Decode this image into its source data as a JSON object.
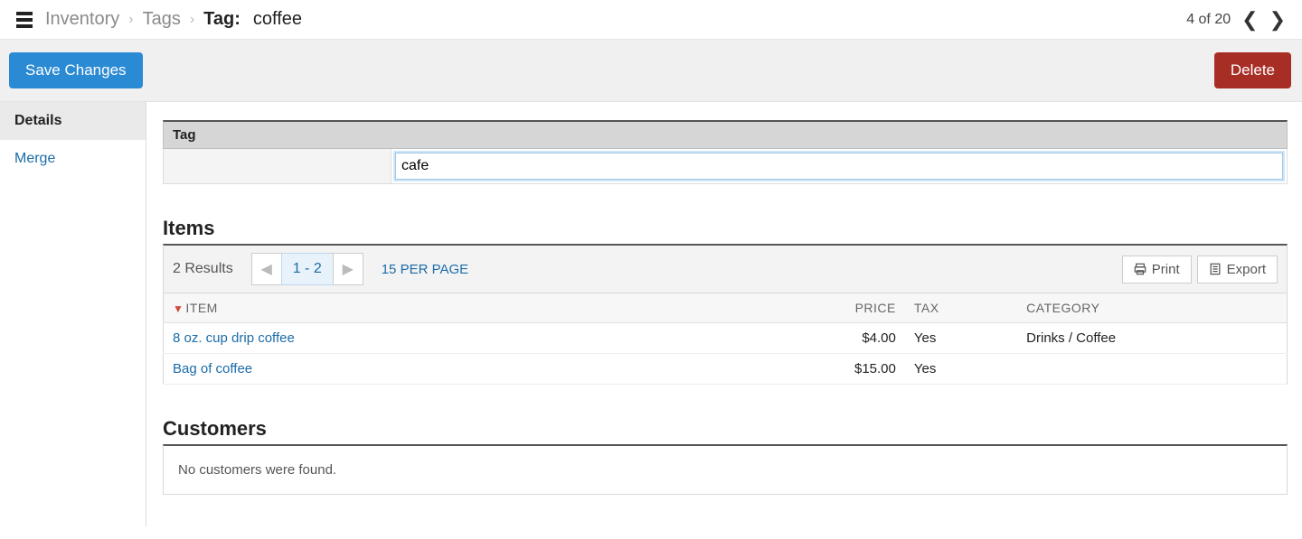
{
  "breadcrumb": {
    "inventory": "Inventory",
    "tags": "Tags",
    "current_label": "Tag:",
    "current_value": "coffee"
  },
  "pager": {
    "position": "4 of 20"
  },
  "actions": {
    "save": "Save Changes",
    "delete": "Delete"
  },
  "sidebar": {
    "details": "Details",
    "merge": "Merge"
  },
  "tag_panel": {
    "header": "Tag",
    "value": "cafe"
  },
  "items": {
    "title": "Items",
    "results_label": "2 Results",
    "range_label": "1 - 2",
    "per_page": "15 PER PAGE",
    "print": "Print",
    "export": "Export",
    "columns": {
      "item": "ITEM",
      "price": "PRICE",
      "tax": "TAX",
      "category": "CATEGORY"
    },
    "rows": [
      {
        "item": "8 oz. cup drip coffee",
        "price": "$4.00",
        "tax": "Yes",
        "category": "Drinks / Coffee"
      },
      {
        "item": "Bag of coffee",
        "price": "$15.00",
        "tax": "Yes",
        "category": ""
      }
    ]
  },
  "customers": {
    "title": "Customers",
    "empty": "No customers were found."
  }
}
